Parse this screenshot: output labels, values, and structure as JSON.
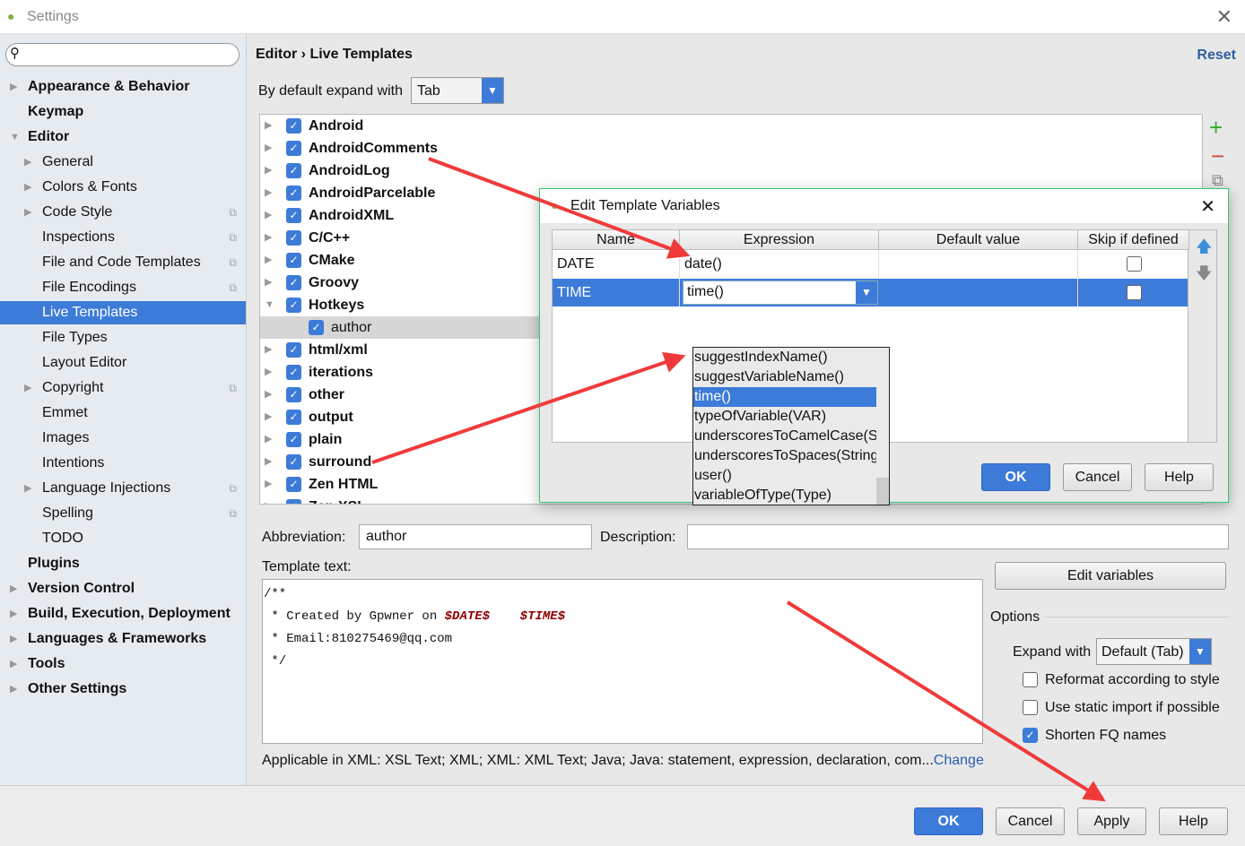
{
  "window": {
    "title": "Settings"
  },
  "sidebar": {
    "search_placeholder": "",
    "items": [
      {
        "label": "Appearance & Behavior",
        "bold": true,
        "level": 0,
        "arrow": "right"
      },
      {
        "label": "Keymap",
        "bold": true,
        "level": 0
      },
      {
        "label": "Editor",
        "bold": true,
        "level": 0,
        "arrow": "down"
      },
      {
        "label": "General",
        "level": 1,
        "arrow": "right"
      },
      {
        "label": "Colors & Fonts",
        "level": 1,
        "arrow": "right"
      },
      {
        "label": "Code Style",
        "level": 1,
        "arrow": "right",
        "copy": true
      },
      {
        "label": "Inspections",
        "level": 1,
        "copy": true
      },
      {
        "label": "File and Code Templates",
        "level": 1,
        "copy": true
      },
      {
        "label": "File Encodings",
        "level": 1,
        "copy": true
      },
      {
        "label": "Live Templates",
        "level": 1,
        "selected": true
      },
      {
        "label": "File Types",
        "level": 1
      },
      {
        "label": "Layout Editor",
        "level": 1
      },
      {
        "label": "Copyright",
        "level": 1,
        "arrow": "right",
        "copy": true
      },
      {
        "label": "Emmet",
        "level": 1
      },
      {
        "label": "Images",
        "level": 1
      },
      {
        "label": "Intentions",
        "level": 1
      },
      {
        "label": "Language Injections",
        "level": 1,
        "arrow": "right",
        "copy": true
      },
      {
        "label": "Spelling",
        "level": 1,
        "copy": true
      },
      {
        "label": "TODO",
        "level": 1
      },
      {
        "label": "Plugins",
        "bold": true,
        "level": 0
      },
      {
        "label": "Version Control",
        "bold": true,
        "level": 0,
        "arrow": "right"
      },
      {
        "label": "Build, Execution, Deployment",
        "bold": true,
        "level": 0,
        "arrow": "right"
      },
      {
        "label": "Languages & Frameworks",
        "bold": true,
        "level": 0,
        "arrow": "right"
      },
      {
        "label": "Tools",
        "bold": true,
        "level": 0,
        "arrow": "right"
      },
      {
        "label": "Other Settings",
        "bold": true,
        "level": 0,
        "arrow": "right"
      }
    ]
  },
  "breadcrumb": {
    "parent": "Editor",
    "sep": "›",
    "current": "Live Templates"
  },
  "reset_label": "Reset",
  "expand": {
    "label": "By default expand with",
    "value": "Tab"
  },
  "tree": [
    {
      "label": "Android"
    },
    {
      "label": "AndroidComments"
    },
    {
      "label": "AndroidLog"
    },
    {
      "label": "AndroidParcelable"
    },
    {
      "label": "AndroidXML"
    },
    {
      "label": "C/C++"
    },
    {
      "label": "CMake"
    },
    {
      "label": "Groovy"
    },
    {
      "label": "Hotkeys",
      "expanded": true
    },
    {
      "label": "author",
      "child": true
    },
    {
      "label": "html/xml"
    },
    {
      "label": "iterations"
    },
    {
      "label": "other"
    },
    {
      "label": "output"
    },
    {
      "label": "plain"
    },
    {
      "label": "surround"
    },
    {
      "label": "Zen HTML"
    },
    {
      "label": "Zen XSL"
    }
  ],
  "abbreviation": {
    "label": "Abbreviation:",
    "value": "author"
  },
  "description": {
    "label": "Description:",
    "value": ""
  },
  "template_text": {
    "label": "Template text:",
    "lines": [
      {
        "text": "/**"
      },
      {
        "text": " * Created by Gpwner on ",
        "var1": "$DATE$",
        "var2": "$TIME$"
      },
      {
        "text": " * Email:810275469@qq.com"
      },
      {
        "text": " */"
      }
    ]
  },
  "applicable": {
    "text": "Applicable in XML: XSL Text; XML; XML: XML Text; Java; Java: statement, expression, declaration, com...",
    "link": "Change"
  },
  "edit_variables_label": "Edit variables",
  "options": {
    "title": "Options",
    "expand_label": "Expand with",
    "expand_value": "Default (Tab)",
    "checks": [
      {
        "label": "Reformat according to style",
        "checked": false
      },
      {
        "label": "Use static import if possible",
        "checked": false
      },
      {
        "label": "Shorten FQ names",
        "checked": true
      }
    ]
  },
  "footer": {
    "ok": "OK",
    "cancel": "Cancel",
    "apply": "Apply",
    "help": "Help"
  },
  "dialog": {
    "title": "Edit Template Variables",
    "columns": [
      "Name",
      "Expression",
      "Default value",
      "Skip if defined"
    ],
    "rows": [
      {
        "name": "DATE",
        "expression": "date()",
        "default": "",
        "skip": false
      },
      {
        "name": "TIME",
        "expression": "time()",
        "default": "",
        "skip": false,
        "selected": true
      }
    ],
    "suggestions": [
      "suggestIndexName()",
      "suggestVariableName()",
      "time()",
      "typeOfVariable(VAR)",
      "underscoresToCamelCase(String)",
      "underscoresToSpaces(String)",
      "user()",
      "variableOfType(Type)"
    ],
    "highlighted_suggestion": "time()",
    "ok": "OK",
    "cancel": "Cancel",
    "help": "Help"
  },
  "colors": {
    "accent": "#3d7bd9",
    "annotation_arrow": "#f03a3a",
    "variable": "#8b0000",
    "dialog_border": "#2ecc71"
  }
}
